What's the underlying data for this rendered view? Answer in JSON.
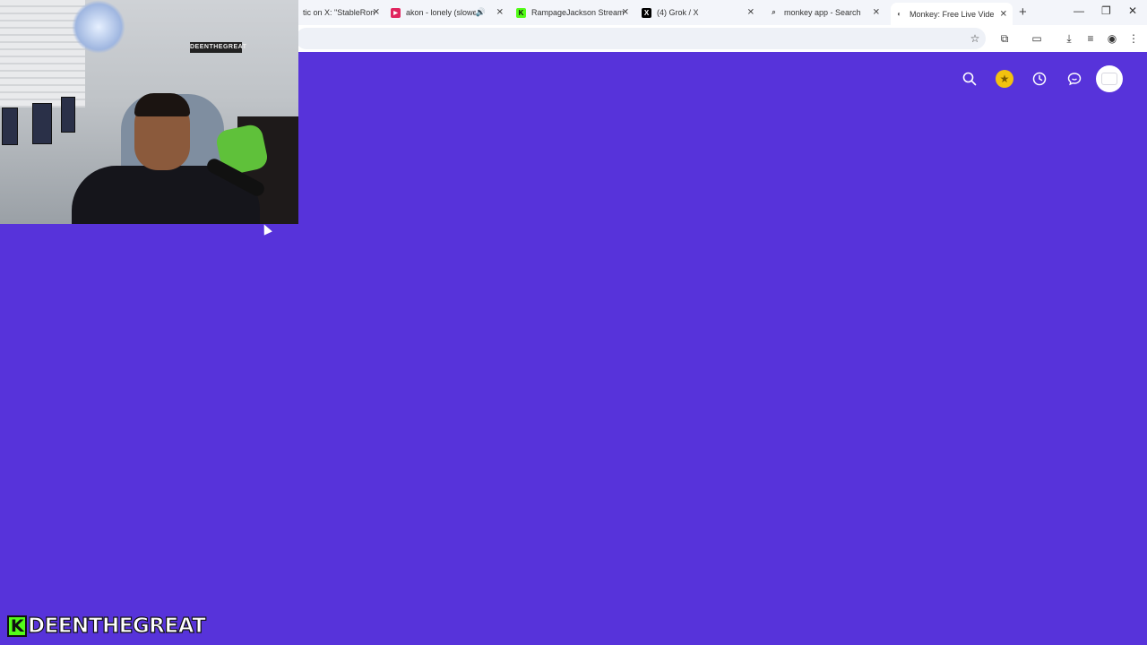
{
  "browser": {
    "tabs": [
      {
        "title": "tic on X: \"StableRon",
        "favicon": "x-icon",
        "active": false
      },
      {
        "title": "akon - lonely (slowed",
        "favicon": "youtube-icon",
        "active": false,
        "audio": true
      },
      {
        "title": "RampageJackson Stream",
        "favicon": "kick-icon",
        "active": false
      },
      {
        "title": "(4) Grok / X",
        "favicon": "x-icon",
        "active": false
      },
      {
        "title": "monkey app - Search",
        "favicon": "search-icon",
        "active": false
      },
      {
        "title": "Monkey: Free Live Video C",
        "favicon": "monkey-icon",
        "active": true
      }
    ],
    "new_tab_symbol": "+",
    "close_symbol": "✕",
    "window_controls": {
      "minimize": "—",
      "restore": "❐",
      "close": "✕"
    }
  },
  "webcam": {
    "wall_sign": "DEENTHEGREAT"
  },
  "page": {
    "background": "#5733da",
    "nav_icons": [
      "search-icon",
      "coin-icon",
      "history-icon",
      "chat-icon",
      "avatar-icon"
    ]
  },
  "watermark": {
    "k": "K",
    "name": "DEENTHEGREAT"
  }
}
